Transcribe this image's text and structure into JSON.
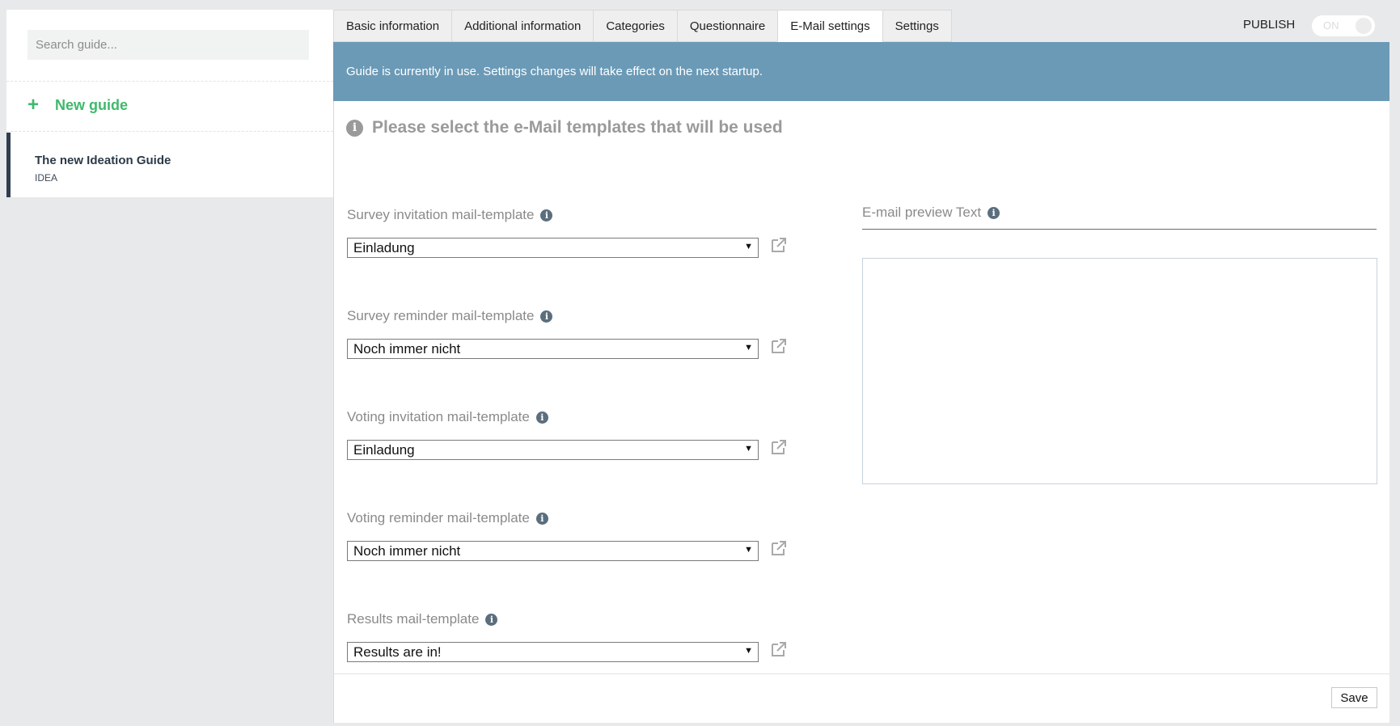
{
  "sidebar": {
    "search_placeholder": "Search guide...",
    "new_guide_label": "New guide",
    "new_guide_icon": "plus-icon",
    "guides": [
      {
        "title": "The new Ideation Guide",
        "code": "IDEA"
      }
    ]
  },
  "tabs": [
    {
      "label": "Basic information"
    },
    {
      "label": "Additional information"
    },
    {
      "label": "Categories"
    },
    {
      "label": "Questionnaire"
    },
    {
      "label": "E-Mail settings"
    },
    {
      "label": "Settings"
    }
  ],
  "active_tab": "E-Mail settings",
  "publish": {
    "label": "PUBLISH",
    "toggle_text": "ON"
  },
  "banner": {
    "text": "Guide is currently in use. Settings changes will take effect on the next startup."
  },
  "section": {
    "title": "Please select the e-Mail templates that will be used",
    "icon": "info-icon"
  },
  "fields": [
    {
      "label": "Survey invitation mail-template",
      "value": "Einladung"
    },
    {
      "label": "Survey reminder mail-template",
      "value": "Noch immer nicht"
    },
    {
      "label": "Voting invitation mail-template",
      "value": "Einladung"
    },
    {
      "label": "Voting reminder mail-template",
      "value": "Noch immer nicht"
    },
    {
      "label": "Results mail-template",
      "value": "Results are in!"
    }
  ],
  "preview": {
    "label": "E-mail preview Text",
    "text": ""
  },
  "footer": {
    "save_label": "Save"
  },
  "colors": {
    "accent_green": "#3fb96b",
    "banner_blue": "#6b9ab6",
    "sidebar_active_border": "#2f3d4e"
  }
}
